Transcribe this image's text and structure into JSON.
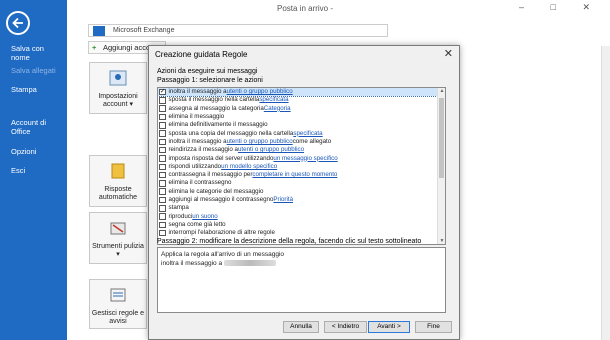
{
  "window": {
    "title": "Posta in arrivo -",
    "controls": "– □ ✕"
  },
  "backstage": {
    "items": [
      {
        "label": "Salva con nome",
        "enabled": true
      },
      {
        "label": "Salva allegati",
        "enabled": false
      },
      {
        "label": "Stampa",
        "enabled": true
      },
      {
        "label": "Account di Office",
        "enabled": true
      },
      {
        "label": "Opzioni",
        "enabled": true
      },
      {
        "label": "Esci",
        "enabled": true
      }
    ]
  },
  "account": {
    "type": "Microsoft Exchange",
    "add_label": "Aggiungi account"
  },
  "tiles": [
    {
      "label": "Impostazioni account ▾"
    },
    {
      "label": "Risposte automatiche"
    },
    {
      "label": "Strumenti pulizia ▾"
    },
    {
      "label": "Gestisci regole e avvisi"
    }
  ],
  "dialog": {
    "title": "Creazione guidata Regole",
    "heading": "Azioni da eseguire sui messaggi",
    "step1": "Passaggio 1: selezionare le azioni",
    "step2": "Passaggio 2: modificare la descrizione della regola, facendo clic sul testo sottolineato",
    "rules": [
      {
        "pre": "inoltra il messaggio a ",
        "link": "utenti o gruppo pubblico",
        "post": "",
        "checked": true,
        "selected": true
      },
      {
        "pre": "sposta il messaggio nella cartella ",
        "link": "specificata",
        "post": "",
        "checked": false,
        "selected": false
      },
      {
        "pre": "assegna al messaggio la categoria ",
        "link": "Categoria",
        "post": "",
        "checked": false,
        "selected": false
      },
      {
        "pre": "elimina il messaggio",
        "link": "",
        "post": "",
        "checked": false,
        "selected": false
      },
      {
        "pre": "elimina definitivamente il messaggio",
        "link": "",
        "post": "",
        "checked": false,
        "selected": false
      },
      {
        "pre": "sposta una copia del messaggio nella cartella ",
        "link": "specificata",
        "post": "",
        "checked": false,
        "selected": false
      },
      {
        "pre": "inoltra il messaggio a ",
        "link": "utenti o gruppo pubblico",
        "post": " come allegato",
        "checked": false,
        "selected": false
      },
      {
        "pre": "reindirizza il messaggio a ",
        "link": "utenti o gruppo pubblico",
        "post": "",
        "checked": false,
        "selected": false
      },
      {
        "pre": "imposta risposta del server utilizzando ",
        "link": "un messaggio specifico",
        "post": "",
        "checked": false,
        "selected": false
      },
      {
        "pre": "rispondi utilizzando ",
        "link": "un modello specifico",
        "post": "",
        "checked": false,
        "selected": false
      },
      {
        "pre": "contrassegna il messaggio per ",
        "link": "completare in questo momento",
        "post": "",
        "checked": false,
        "selected": false
      },
      {
        "pre": "elimina il contrassegno",
        "link": "",
        "post": "",
        "checked": false,
        "selected": false
      },
      {
        "pre": "elimina le categorie del messaggio",
        "link": "",
        "post": "",
        "checked": false,
        "selected": false
      },
      {
        "pre": "aggiungi al messaggio il contrassegno ",
        "link": "Priorità",
        "post": "",
        "checked": false,
        "selected": false
      },
      {
        "pre": "stampa",
        "link": "",
        "post": "",
        "checked": false,
        "selected": false
      },
      {
        "pre": "riproduci ",
        "link": "un suono",
        "post": "",
        "checked": false,
        "selected": false
      },
      {
        "pre": "segna come già letto",
        "link": "",
        "post": "",
        "checked": false,
        "selected": false
      },
      {
        "pre": "interrompi l'elaborazione di altre regole",
        "link": "",
        "post": "",
        "checked": false,
        "selected": false
      }
    ],
    "description": {
      "line1": "Applica la regola all'arrivo di un messaggio",
      "line2_pre": "inoltra il messaggio a "
    },
    "buttons": {
      "cancel": "Annulla",
      "back": "< Indietro",
      "next": "Avanti >",
      "finish": "Fine"
    }
  }
}
